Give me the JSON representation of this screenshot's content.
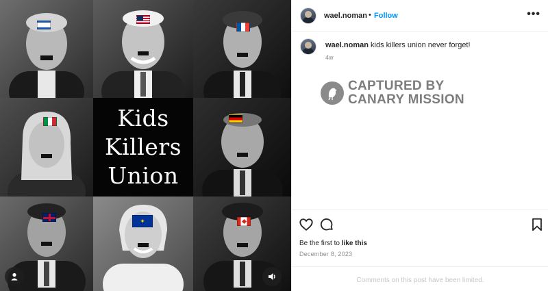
{
  "post": {
    "media": {
      "center_text": [
        "Kids",
        "Killers",
        "Union"
      ],
      "tiles": [
        {
          "flag": "israel-flag"
        },
        {
          "flag": "usa-flag"
        },
        {
          "flag": "france-flag"
        },
        {
          "flag": "italy-flag"
        },
        {
          "flag": "germany-flag"
        },
        {
          "flag": "uk-flag"
        },
        {
          "flag": "eu-flag"
        },
        {
          "flag": "canada-flag"
        }
      ],
      "user_tag_icon": "person-icon",
      "sound_icon": "speaker-icon"
    },
    "header": {
      "username": "wael.noman",
      "separator": "•",
      "follow_label": "Follow",
      "more_icon": "more-options-icon",
      "more_label": "•••"
    },
    "caption": {
      "username": "wael.noman",
      "text": "kids killers union never forget!",
      "time_ago": "4w"
    },
    "watermark": {
      "line1": "CAPTURED BY",
      "line2": "CANARY MISSION",
      "logo_icon": "canary-bird-icon"
    },
    "actions": {
      "like_icon": "heart-icon",
      "comment_icon": "comment-icon",
      "save_icon": "bookmark-icon",
      "likes_prefix": "Be the first to ",
      "likes_link": "like this",
      "date": "December 8, 2023"
    },
    "footer": {
      "comments_limited": "Comments on this post have been limited."
    }
  }
}
